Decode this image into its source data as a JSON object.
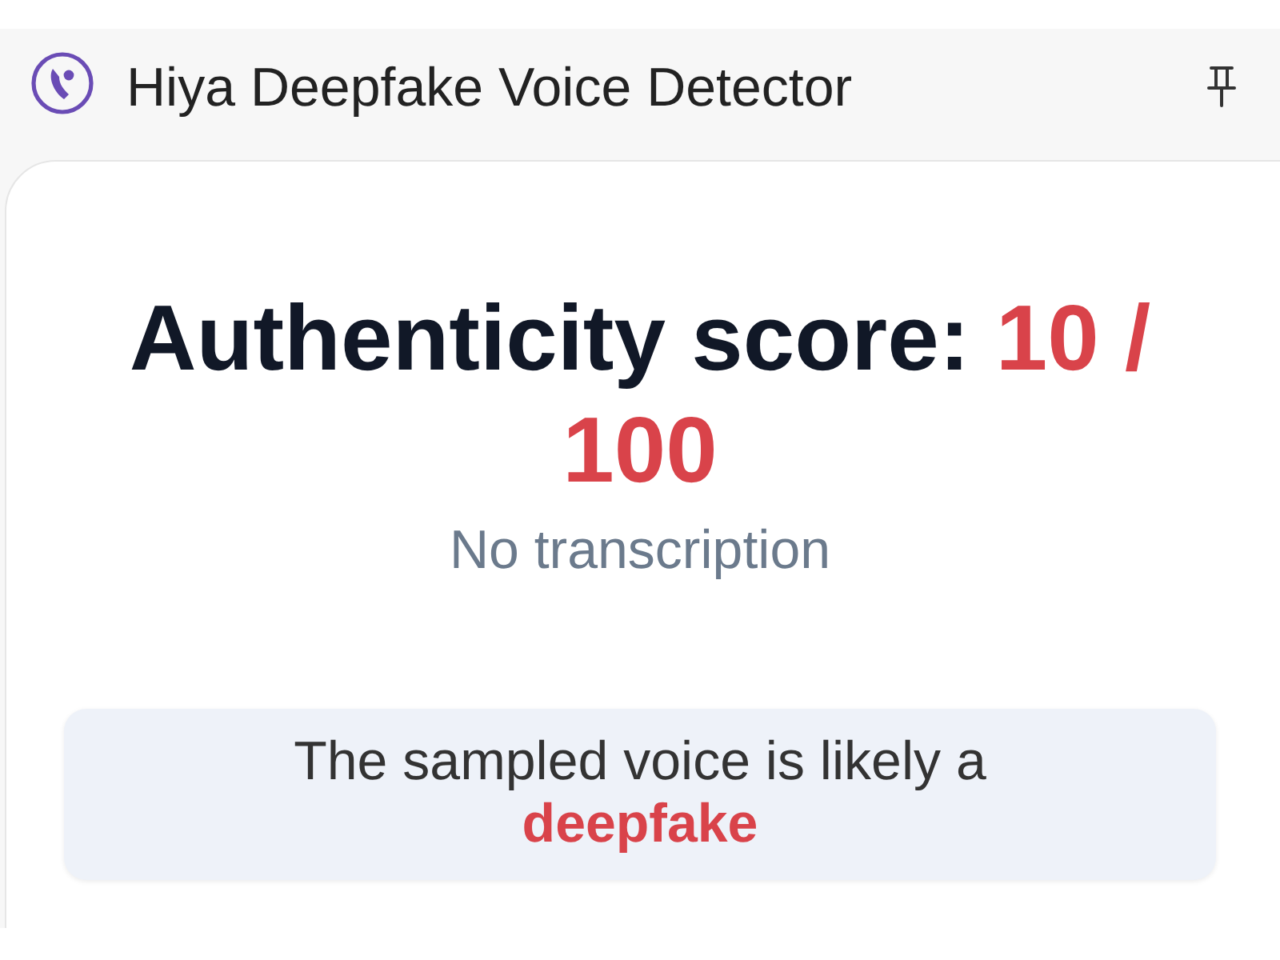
{
  "panel": {
    "title": "Hiya Deepfake Voice Detector"
  },
  "result": {
    "score_label": "Authenticity score:",
    "score": "10 / 100",
    "transcription": "No transcription",
    "verdict": "The sampled voice is likely a **deepfake**"
  }
}
